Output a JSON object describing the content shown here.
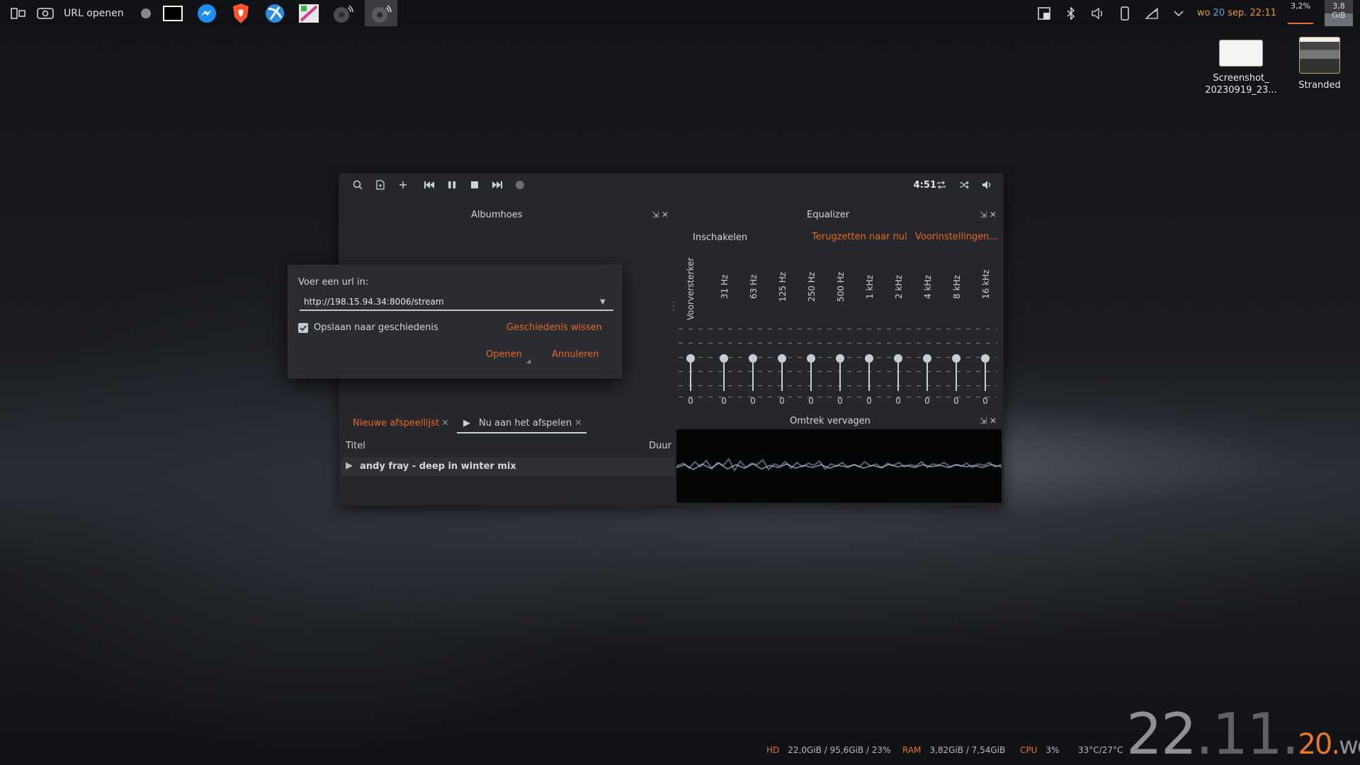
{
  "topbar": {
    "window_title": "URL openen",
    "date_day": "wo",
    "date_num": "20",
    "date_month": "sep.",
    "time": "22:11",
    "cpu_percent": "3,2%",
    "memory": "3,8 GiB"
  },
  "desktop": {
    "icons": [
      {
        "label_line1": "Screenshot_",
        "label_line2": "20230919_23..."
      },
      {
        "label_line1": "Stranded",
        "label_line2": ""
      }
    ]
  },
  "player": {
    "time": "4:51",
    "albumart_title": "Albumhoes",
    "equalizer": {
      "title": "Equalizer",
      "enable_label": "Inschakelen",
      "reset_label": "Terugzetten naar nul",
      "presets_label": "Voorinstellingen...",
      "preamp_label": "Voorversterker",
      "bands": [
        "31 Hz",
        "63 Hz",
        "125 Hz",
        "250 Hz",
        "500 Hz",
        "1 kHz",
        "2 kHz",
        "4 kHz",
        "8 kHz",
        "16 kHz"
      ],
      "values": [
        "0",
        "0",
        "0",
        "0",
        "0",
        "0",
        "0",
        "0",
        "0",
        "0",
        "0"
      ]
    },
    "tabs": [
      {
        "label": "Nieuwe afspeellijst"
      },
      {
        "label": "Nu aan het afspelen"
      }
    ],
    "playlist": {
      "col_title": "Titel",
      "col_duration": "Duur",
      "rows": [
        {
          "title": "andy fray - deep in winter mix"
        }
      ]
    },
    "visualizer_title": "Omtrek vervagen"
  },
  "url_dialog": {
    "prompt": "Voer een url in:",
    "url_value": "http://198.15.94.34:8006/stream",
    "save_history_label": "Opslaan naar geschiedenis",
    "save_history_checked": true,
    "clear_history_label": "Geschiedenis wissen",
    "open_label": "Openen",
    "cancel_label": "Annuleren"
  },
  "statusbar": {
    "hd_label": "HD",
    "hd_value": "22,0GiB / 95,6GiB / 23%",
    "ram_label": "RAM",
    "ram_value": "3,82GiB / 7,54GiB",
    "cpu_label": "CPU",
    "cpu_value": "3%",
    "temp_value": "33°C/27°C",
    "clock_hour": "22",
    "clock_min": "11",
    "clock_day": "20",
    "clock_weekday": "wo"
  },
  "colors": {
    "accent": "#e86a24",
    "date_blue": "#5aa7e6"
  }
}
